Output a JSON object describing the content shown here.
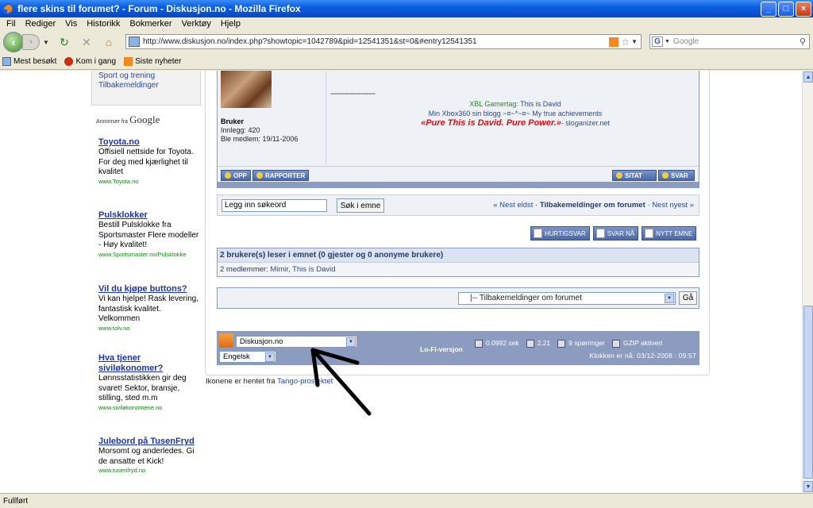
{
  "window": {
    "title": "flere skins til forumet? - Forum - Diskusjon.no - Mozilla Firefox",
    "buttons": {
      "minimize": "_",
      "maximize": "□",
      "close": "×"
    }
  },
  "menu": [
    "Fil",
    "Rediger",
    "Vis",
    "Historikk",
    "Bokmerker",
    "Verktøy",
    "Hjelp"
  ],
  "nav": {
    "url": "http://www.diskusjon.no/index.php?showtopic=1042789&pid=12541351&st=0&#entry12541351",
    "search_placeholder": "Google"
  },
  "bookmarks": [
    "Mest besøkt",
    "Kom i gang",
    "Siste nyheter"
  ],
  "sidebar": {
    "links": [
      "Sport og trening",
      "Tilbakemeldinger"
    ]
  },
  "ads": {
    "header_prefix": "Annonser fra",
    "header_brand": "Google",
    "items": [
      {
        "title": "Toyota.no",
        "desc": "Offisiell nettside for Toyota. For deg med kjærlighet til kvalitet",
        "url": "www.Toyota.no"
      },
      {
        "title": "Pulsklokker",
        "desc": "Bestill Pulsklokke fra Sportsmaster Flere modeller - Høy kvalitet!",
        "url": "www.Sportsmaster.no/Pulsklokke"
      },
      {
        "title": "Vil du kjøpe buttons?",
        "desc": "Vi kan hjelpe! Rask levering, fantastisk kvalitet. Velkommen",
        "url": "www.tolv.no"
      },
      {
        "title": "Hva tjener siviløkonomer?",
        "desc": "Lønnsstatistikken gir deg svaret! Sektor, bransje, stilling, sted m.m",
        "url": "www.siviløkonomene.no"
      },
      {
        "title": "Julebord på TusenFryd",
        "desc": "Morsomt og anderledes. Gi de ansatte et Kick!",
        "url": "www.tusenfryd.no"
      }
    ]
  },
  "post": {
    "rank": "Bruker",
    "posts": "Innlegg: 420",
    "member_since": "Ble medlem: 19/11-2006",
    "divider": "--------------------",
    "sig_gamertag_label": "XBL Gamertag: ",
    "sig_gamertag_value": "This is David",
    "sig_blog": "Min Xbox360 sin blogg ~¤~*~¤~ My true achievements",
    "sig_slogan": "«Pure This is David. Pure Power.»",
    "sig_slogan_suffix": "- sloganizer.net",
    "btn_opp": "OPP",
    "btn_rapporter": "RAPPORTER",
    "btn_sitat": "SITAT",
    "btn_svar": "SVAR"
  },
  "topic_search": {
    "value": "Legg inn søkeord",
    "button": "Søk i emne",
    "prev": "« Nest eldst",
    "sep": " · ",
    "forum": "Tilbakemeldinger om forumet",
    "next": "Nest nyest »"
  },
  "actions": [
    "HURTIGSVAR",
    "SVAR NÅ",
    "NYTT EMNE"
  ],
  "readers": {
    "heading": "2 brukere(s) leser i emnet (0 gjester og 0 anonyme brukere)",
    "prefix": "2 medlemmer: ",
    "members": [
      "Mimir",
      "This is David"
    ]
  },
  "jump": {
    "selected": "|-- Tilbakemeldinger om forumet",
    "go": "Gå"
  },
  "footer": {
    "skin": "Diskusjon.no",
    "language": "Engelsk",
    "lofi": "Lo-Fi-versjon",
    "stats": [
      "0.0992 sek",
      "2.21",
      "9 spørringer",
      "GZIP aktivert"
    ],
    "clock": "Klokken er nå: 03/12-2008 : 09:57"
  },
  "credits": {
    "text": "Ikonene er hentet fra ",
    "link": "Tango-prosjektet"
  },
  "status": "Fullført"
}
